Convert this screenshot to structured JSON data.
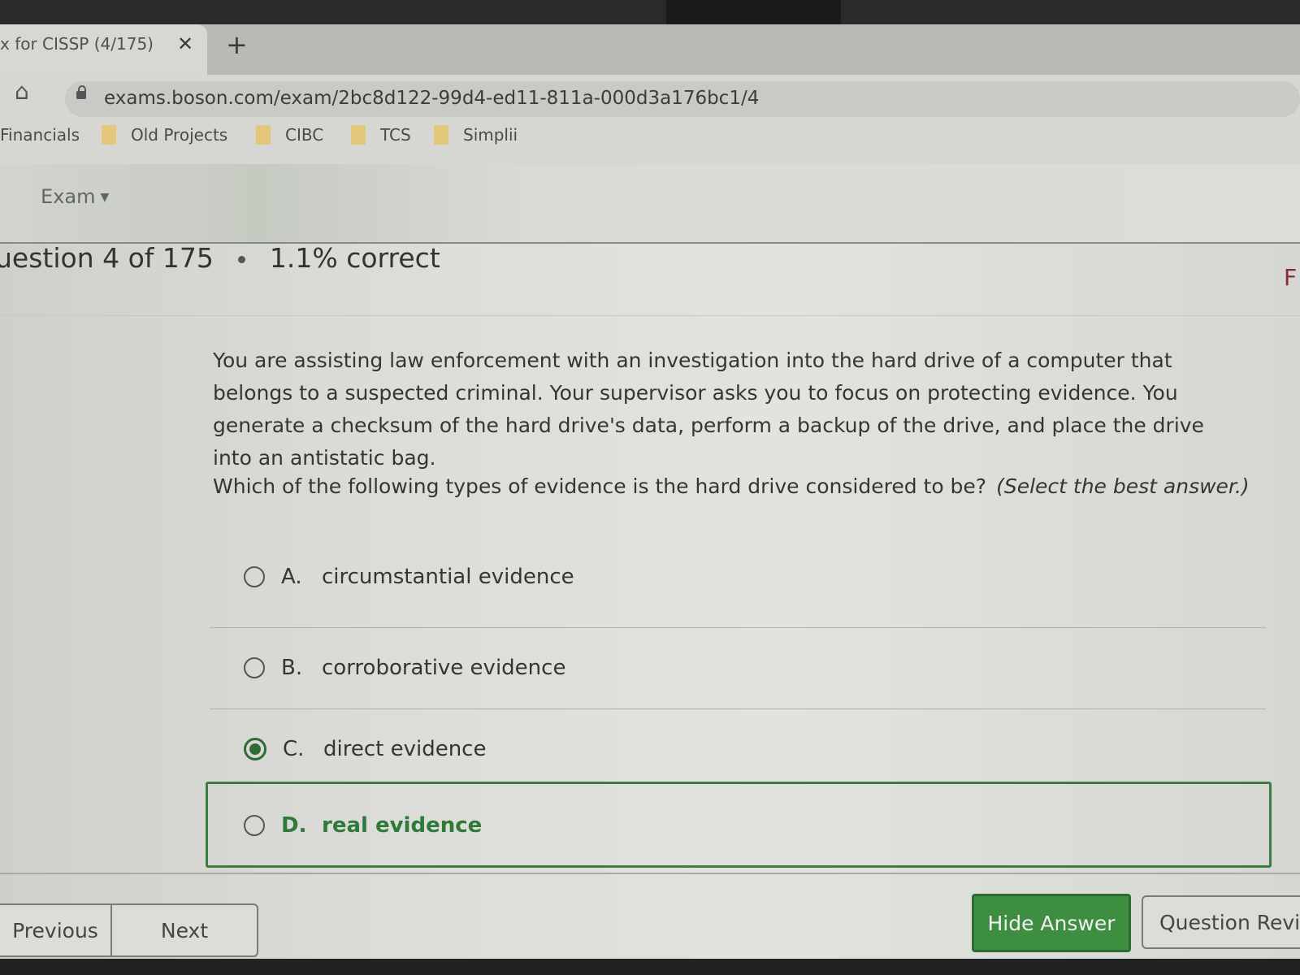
{
  "browser": {
    "tab_title": "x for CISSP (4/175)",
    "tab_close_icon": "close-icon",
    "new_tab_icon": "plus-icon",
    "url": "exams.boson.com/exam/2bc8d122-99d4-ed11-811a-000d3a176bc1/4",
    "bookmarks": [
      "Financials",
      "Old Projects",
      "CIBC",
      "TCS",
      "Simplii"
    ]
  },
  "nav": {
    "exam_menu": "Exam"
  },
  "status": {
    "question_progress": "uestion 4 of 175",
    "score": "1.1% correct",
    "flag_label": "F"
  },
  "question": {
    "body": "You are assisting law enforcement with an investigation into the hard drive of a computer that belongs to a suspected criminal. Your supervisor asks you to focus on protecting evidence. You generate a checksum of the hard drive's data, perform a backup of the drive, and place the drive into an antistatic bag.",
    "prompt": "Which of the following types of evidence is the hard drive considered to be?",
    "instruction": "(Select the best answer.)"
  },
  "options": [
    {
      "letter": "A.",
      "text": "circumstantial evidence",
      "selected": false,
      "correct": false
    },
    {
      "letter": "B.",
      "text": "corroborative evidence",
      "selected": false,
      "correct": false
    },
    {
      "letter": "C.",
      "text": "direct evidence",
      "selected": true,
      "correct": false
    },
    {
      "letter": "D.",
      "text": "real evidence",
      "selected": false,
      "correct": true
    }
  ],
  "footer": {
    "previous": "Previous",
    "next": "Next",
    "hide_answer": "Hide Answer",
    "question_review": "Question Review"
  },
  "colors": {
    "accent_green": "#3e8e41",
    "correct_text": "#2f7a3a",
    "flag": "#8a2a35"
  }
}
